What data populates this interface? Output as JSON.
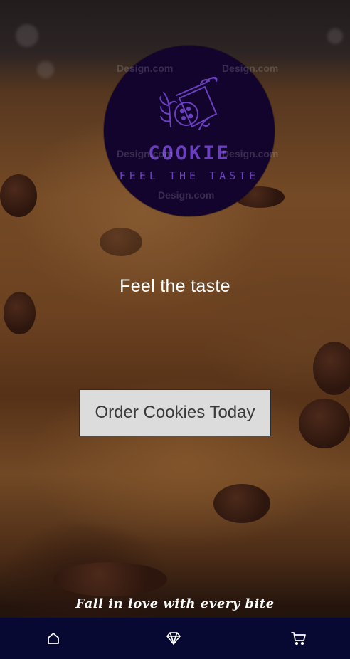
{
  "logo": {
    "brand": "COOKIE",
    "tagline": "FEEL THE TASTE",
    "watermarks": [
      "Design.com",
      "Design.com",
      "Design.com",
      "Design.com",
      "Design.com"
    ],
    "color": "#6a3fc0",
    "background": "#13042e"
  },
  "hero": {
    "headline": "Feel the taste"
  },
  "cta": {
    "label": "Order Cookies Today"
  },
  "footer": {
    "slogan": "Fall in love with every bite"
  },
  "navbar": {
    "background": "#070933",
    "items": [
      {
        "icon": "home-icon"
      },
      {
        "icon": "diamond-icon"
      },
      {
        "icon": "cart-icon"
      }
    ]
  }
}
